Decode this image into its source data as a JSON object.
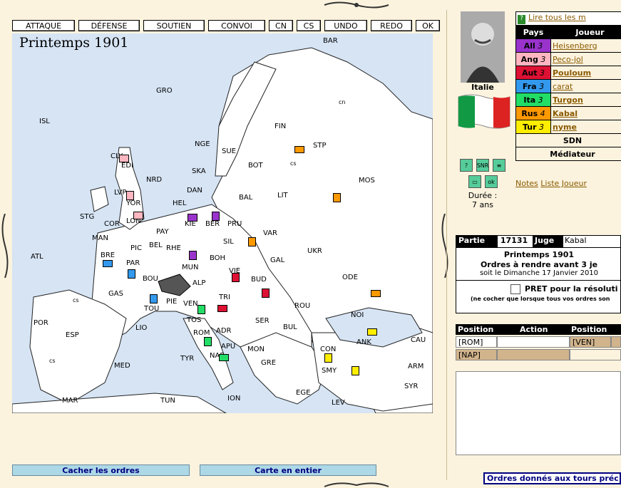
{
  "toolbar": {
    "buttons": [
      "ATTAQUE",
      "DÉFENSE",
      "SOUTIEN",
      "CONVOI",
      "CN",
      "CS",
      "UNDO",
      "REDO",
      "OK"
    ]
  },
  "map": {
    "title": "Printemps 1901",
    "provinces": [
      "BAR",
      "GRO",
      "ISL",
      "NGE",
      "FIN",
      "STP",
      "SUE",
      "BOT",
      "NRD",
      "EDI",
      "SKA",
      "CLY",
      "YOR",
      "LVP",
      "DAN",
      "BAL",
      "LIT",
      "MOS",
      "STG",
      "LON",
      "HEL",
      "KIE",
      "BER",
      "PRU",
      "MAN",
      "COR",
      "PAY",
      "BEL",
      "PIC",
      "SIL",
      "VAR",
      "ATL",
      "BRE",
      "RHE",
      "BOH",
      "GAL",
      "UKR",
      "PAR",
      "MUN",
      "VIE",
      "BUD",
      "BOU",
      "GAS",
      "ALP",
      "TRI",
      "ODE",
      "PIE",
      "TOU",
      "VEN",
      "ROU",
      "NOI",
      "POR",
      "ESP",
      "LIO",
      "TOS",
      "SER",
      "BUL",
      "ROM",
      "ADR",
      "ANK",
      "CAU",
      "MED",
      "APU",
      "MON",
      "CON",
      "NAP",
      "TYR",
      "GRE",
      "SMY",
      "ARM",
      "MAR",
      "TUN",
      "ION",
      "EGE",
      "LEV",
      "SYR",
      "cs",
      "cs",
      "cn",
      "cs"
    ]
  },
  "bottom_buttons": {
    "hide_orders": "Cacher les ordres",
    "full_map": "Carte en entier"
  },
  "player": {
    "country": "Italie",
    "duration_label": "Durée :",
    "duration_value": "7 ans"
  },
  "players_table": {
    "read_all": "Lire tous les m",
    "col_country": "Pays",
    "col_player": "Joueur",
    "rows": [
      {
        "country": "All",
        "count": "3",
        "player": "Heisenberg",
        "color": "#9933CC",
        "bold": false
      },
      {
        "country": "Ang",
        "count": "3",
        "player": "Peco-jol",
        "color": "#FFB6C1",
        "bold": false
      },
      {
        "country": "Aut",
        "count": "3",
        "player": "Pouloum",
        "color": "#DD1133",
        "bold": true
      },
      {
        "country": "Fra",
        "count": "3",
        "player": "carat",
        "color": "#3399EE",
        "bold": false
      },
      {
        "country": "Ita",
        "count": "3",
        "player": "Turgon",
        "color": "#22DD66",
        "bold": true
      },
      {
        "country": "Rus",
        "count": "4",
        "player": "Kabal",
        "color": "#FF9900",
        "bold": true
      },
      {
        "country": "Tur",
        "count": "3",
        "player": "nyme",
        "color": "#FFEE00",
        "bold": true
      }
    ],
    "sdn": "SDN",
    "mediator": "Médiateur"
  },
  "links": {
    "notes": "Notes",
    "player_list": "Liste Joueur"
  },
  "game": {
    "label_partie": "Partie",
    "number": "17131",
    "label_juge": "Juge",
    "judge": "Kabal",
    "season": "Printemps 1901",
    "deadline": "Ordres à rendre avant 3 je",
    "date": "soit le Dimanche 17 Janvier 2010",
    "ready_label": "PRET pour la résoluti",
    "ready_note": "(ne cocher que lorsque tous vos ordres son"
  },
  "orders": {
    "headers": [
      "Position",
      "Action",
      "Position"
    ],
    "rows": [
      [
        "[ROM]",
        "",
        "[VEN]"
      ],
      [
        "[NAP]",
        "",
        ""
      ]
    ]
  },
  "previous_orders": "Ordres donnés aux tours préc",
  "colors": {
    "background": "#FBF3DE",
    "sea": "#D6E4F4",
    "button_blue": "#ADD8E6"
  }
}
